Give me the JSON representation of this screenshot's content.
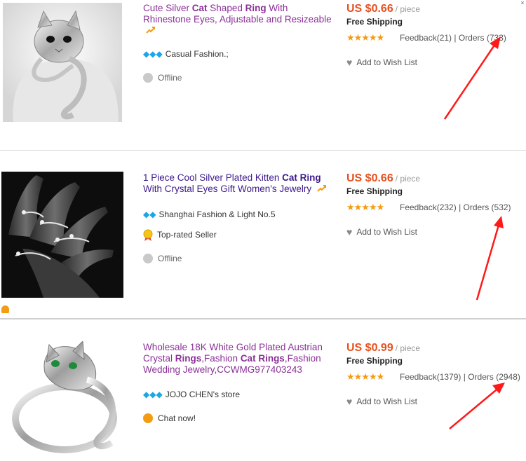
{
  "items": [
    {
      "title_parts": [
        {
          "text": "Cute Silver ",
          "bold": false
        },
        {
          "text": "Cat",
          "bold": true
        },
        {
          "text": " Shaped ",
          "bold": false
        },
        {
          "text": "Ring",
          "bold": true
        },
        {
          "text": " With Rhinestone Eyes, Adjustable and Resizeable",
          "bold": false
        }
      ],
      "trend_icon": "trend-up-icon",
      "store_diamonds": "◆◆◆",
      "store_name": "Casual Fashion.;",
      "status": "Offline",
      "price": "US $0.66",
      "per": "/ piece",
      "shipping": "Free Shipping",
      "stars": "★★★★★",
      "feedback": "Feedback(21)",
      "orders": "Orders (733)",
      "wish": "Add to Wish List"
    },
    {
      "title_parts": [
        {
          "text": "1 Piece Cool Silver Plated Kitten ",
          "bold": false
        },
        {
          "text": "Cat Ring",
          "bold": true
        },
        {
          "text": " With Crystal Eyes Gift Women's Jewelry",
          "bold": false
        }
      ],
      "trend_icon": "trend-up-icon",
      "store_diamonds": "◆◆",
      "store_name": "Shanghai Fashion & Light No.5",
      "badge": "Top-rated Seller",
      "status": "Offline",
      "price": "US $0.66",
      "per": "/ piece",
      "shipping": "Free Shipping",
      "stars": "★★★★★",
      "feedback": "Feedback(232)",
      "orders": "Orders (532)",
      "wish": "Add to Wish List"
    },
    {
      "title_parts": [
        {
          "text": "Wholesale 18K White Gold Plated Austrian Crystal ",
          "bold": false
        },
        {
          "text": "Rings",
          "bold": true
        },
        {
          "text": ",Fashion ",
          "bold": false
        },
        {
          "text": "Cat Rings",
          "bold": true
        },
        {
          "text": ",Fashion Wedding Jewelry,CCWMG977403243",
          "bold": false
        }
      ],
      "store_diamonds": "◆◆◆",
      "store_name": "JOJO CHEN's store",
      "status": "Chat now!",
      "price": "US $0.99",
      "per": "/ piece",
      "shipping": "Free Shipping",
      "stars": "★★★★★",
      "feedback": "Feedback(1379)",
      "orders": "Orders (2948)",
      "wish": "Add to Wish List"
    }
  ],
  "colors": {
    "price": "#e6501e",
    "title": "#3c1a8c",
    "star": "#f39c12",
    "diamond": "#1aa6e8",
    "arrow": "#ff1a1a"
  }
}
